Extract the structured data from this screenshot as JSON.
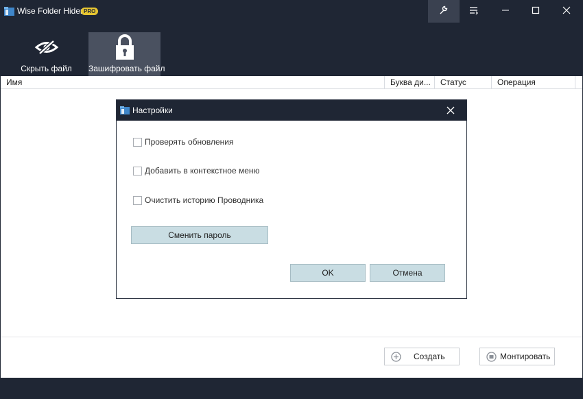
{
  "window": {
    "title": "Wise Folder Hider",
    "badge": "PRO"
  },
  "toolbar": {
    "hide_label": "Скрыть файл",
    "encrypt_label": "Зашифровать файл"
  },
  "columns": [
    "Имя",
    "Буква ди...",
    "Статус",
    "Операция"
  ],
  "actions": {
    "create_label": "Создать",
    "mount_label": "Монтировать"
  },
  "dialog": {
    "title": "Настройки",
    "options": [
      {
        "label": "Проверять обновления",
        "checked": false
      },
      {
        "label": "Добавить в контекстное меню",
        "checked": false
      },
      {
        "label": "Очистить историю Проводника",
        "checked": false
      }
    ],
    "change_password_label": "Сменить пароль",
    "ok_label": "OK",
    "cancel_label": "Отмена"
  },
  "colors": {
    "chrome": "#1f2634",
    "selected_tool": "#4a5160",
    "accent_badge": "#e6c531",
    "dialog_button": "#c9dde3"
  }
}
